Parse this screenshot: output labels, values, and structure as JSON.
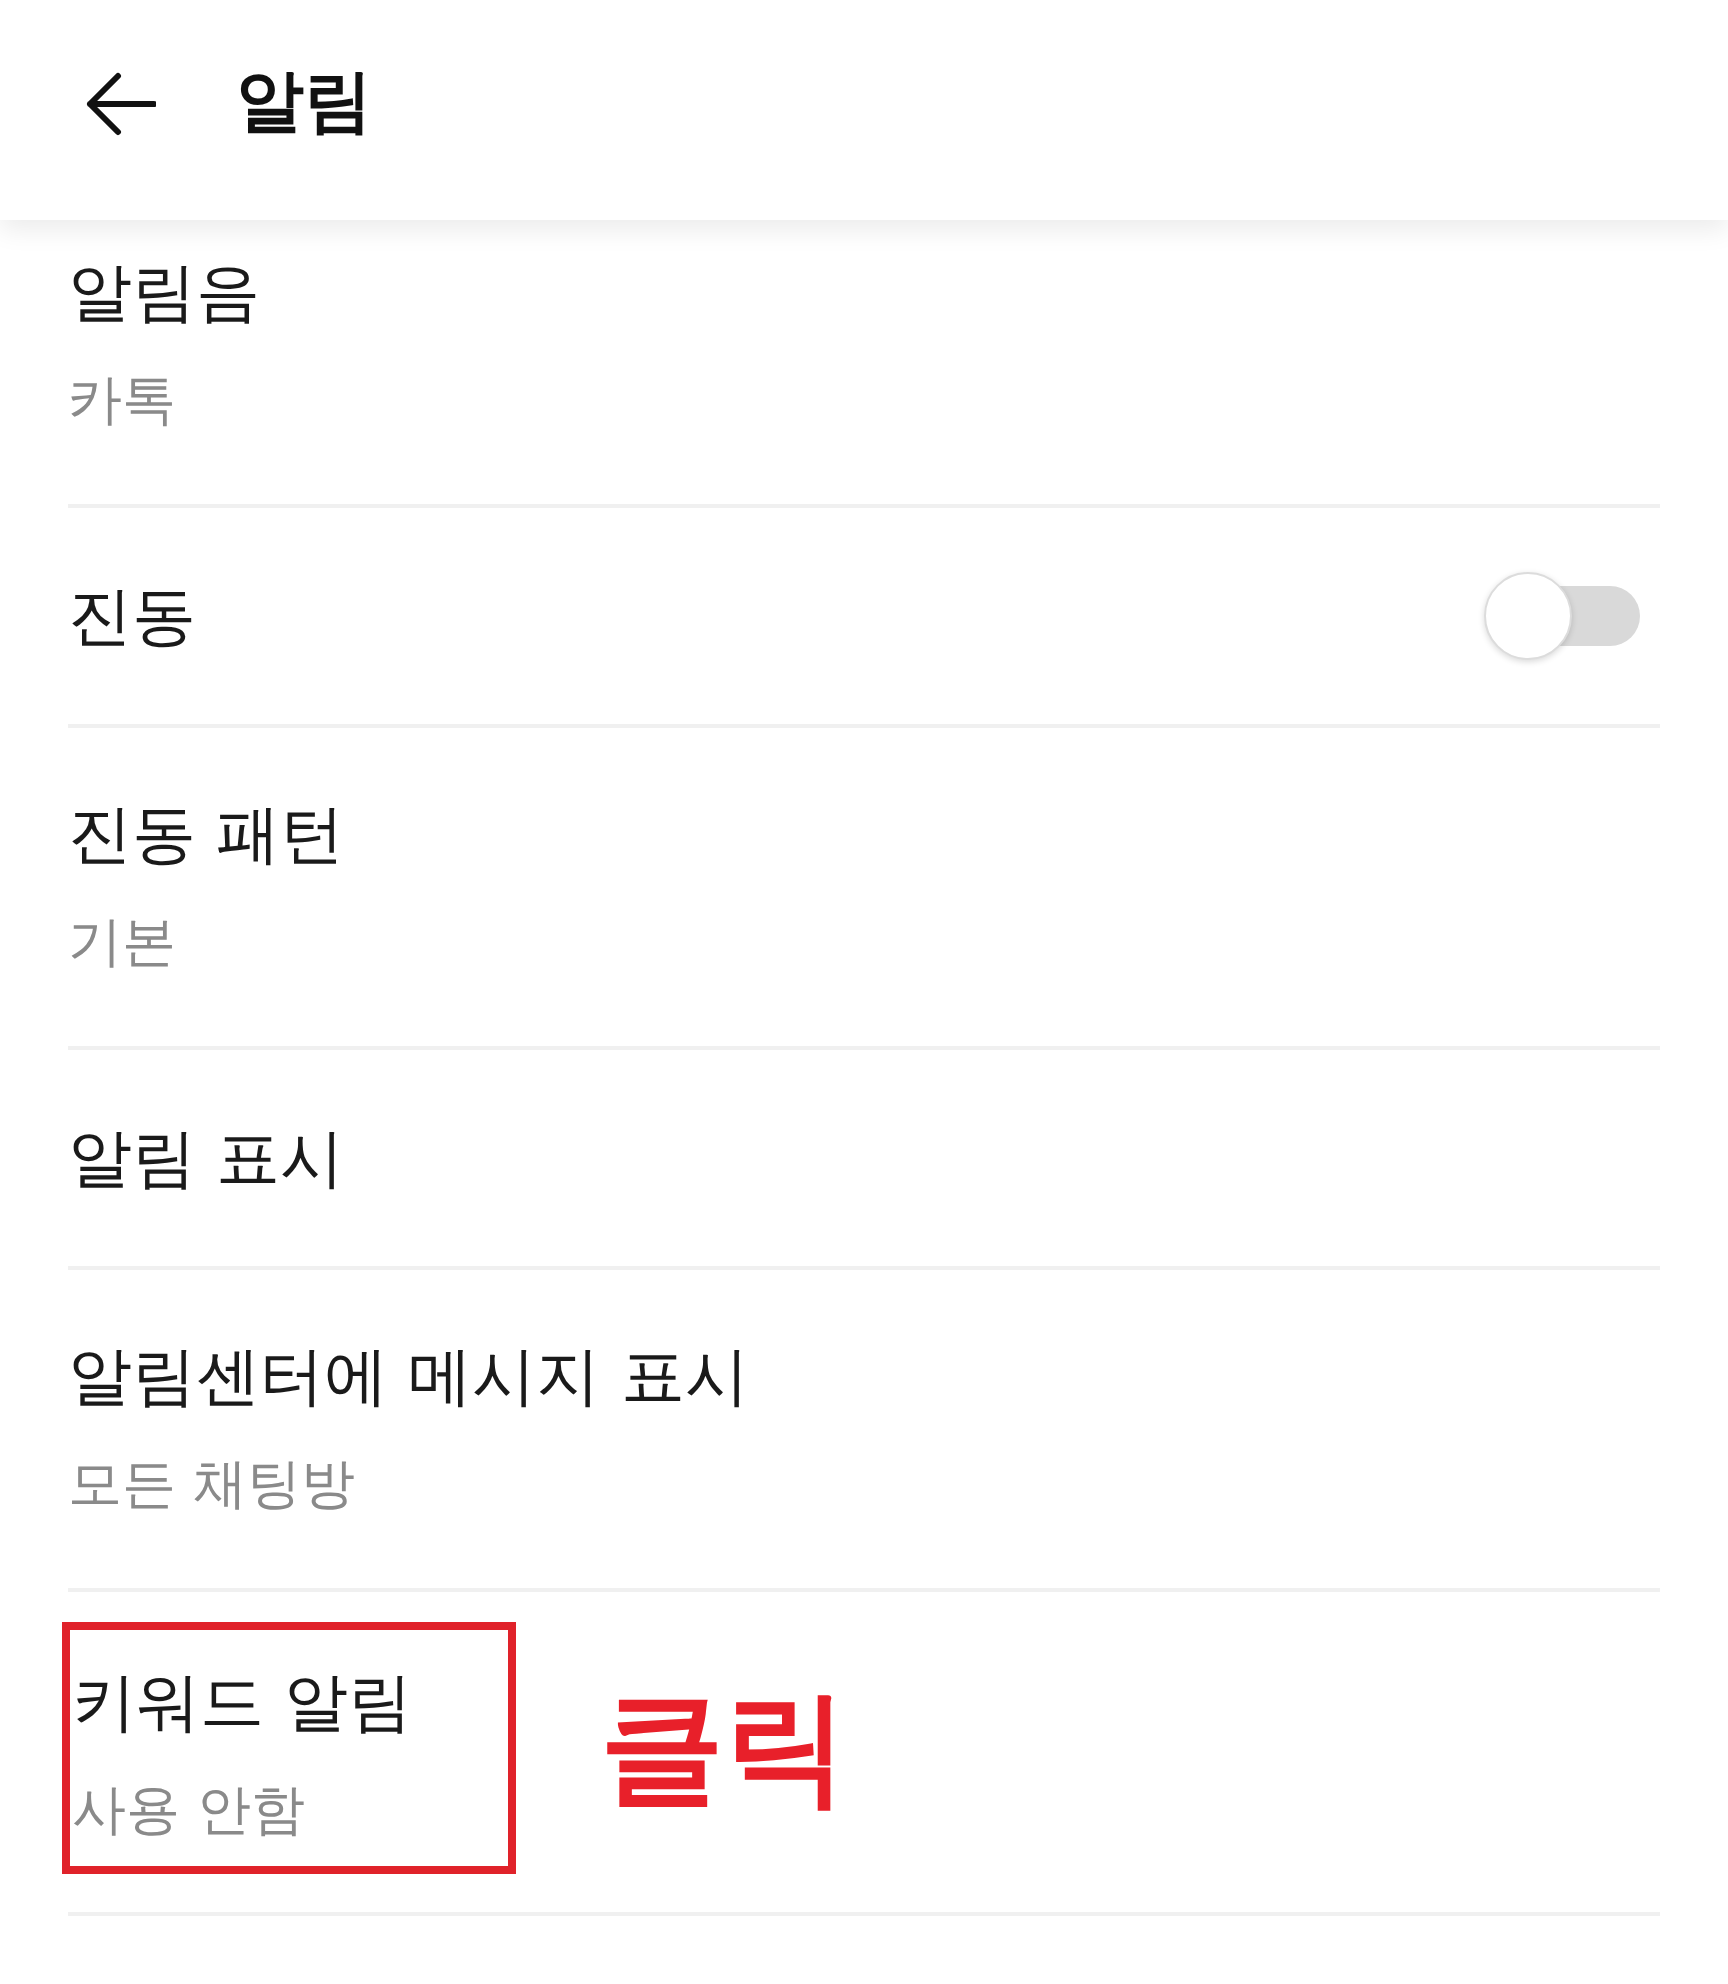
{
  "header": {
    "title": "알림"
  },
  "items": [
    {
      "kind": "text",
      "label": "알림음",
      "value": "카톡",
      "highlighted": false
    },
    {
      "kind": "toggle",
      "label": "진동",
      "on": false,
      "highlighted": false
    },
    {
      "kind": "text",
      "label": "진동 패턴",
      "value": "기본",
      "highlighted": false
    },
    {
      "kind": "text",
      "label": "알림 표시",
      "highlighted": false
    },
    {
      "kind": "text",
      "label": "알림센터에 메시지 표시",
      "value": "모든 채팅방",
      "highlighted": false
    },
    {
      "kind": "text",
      "label": "키워드 알림",
      "value": "사용 안함",
      "highlighted": true,
      "callout": "클릭"
    }
  ]
}
